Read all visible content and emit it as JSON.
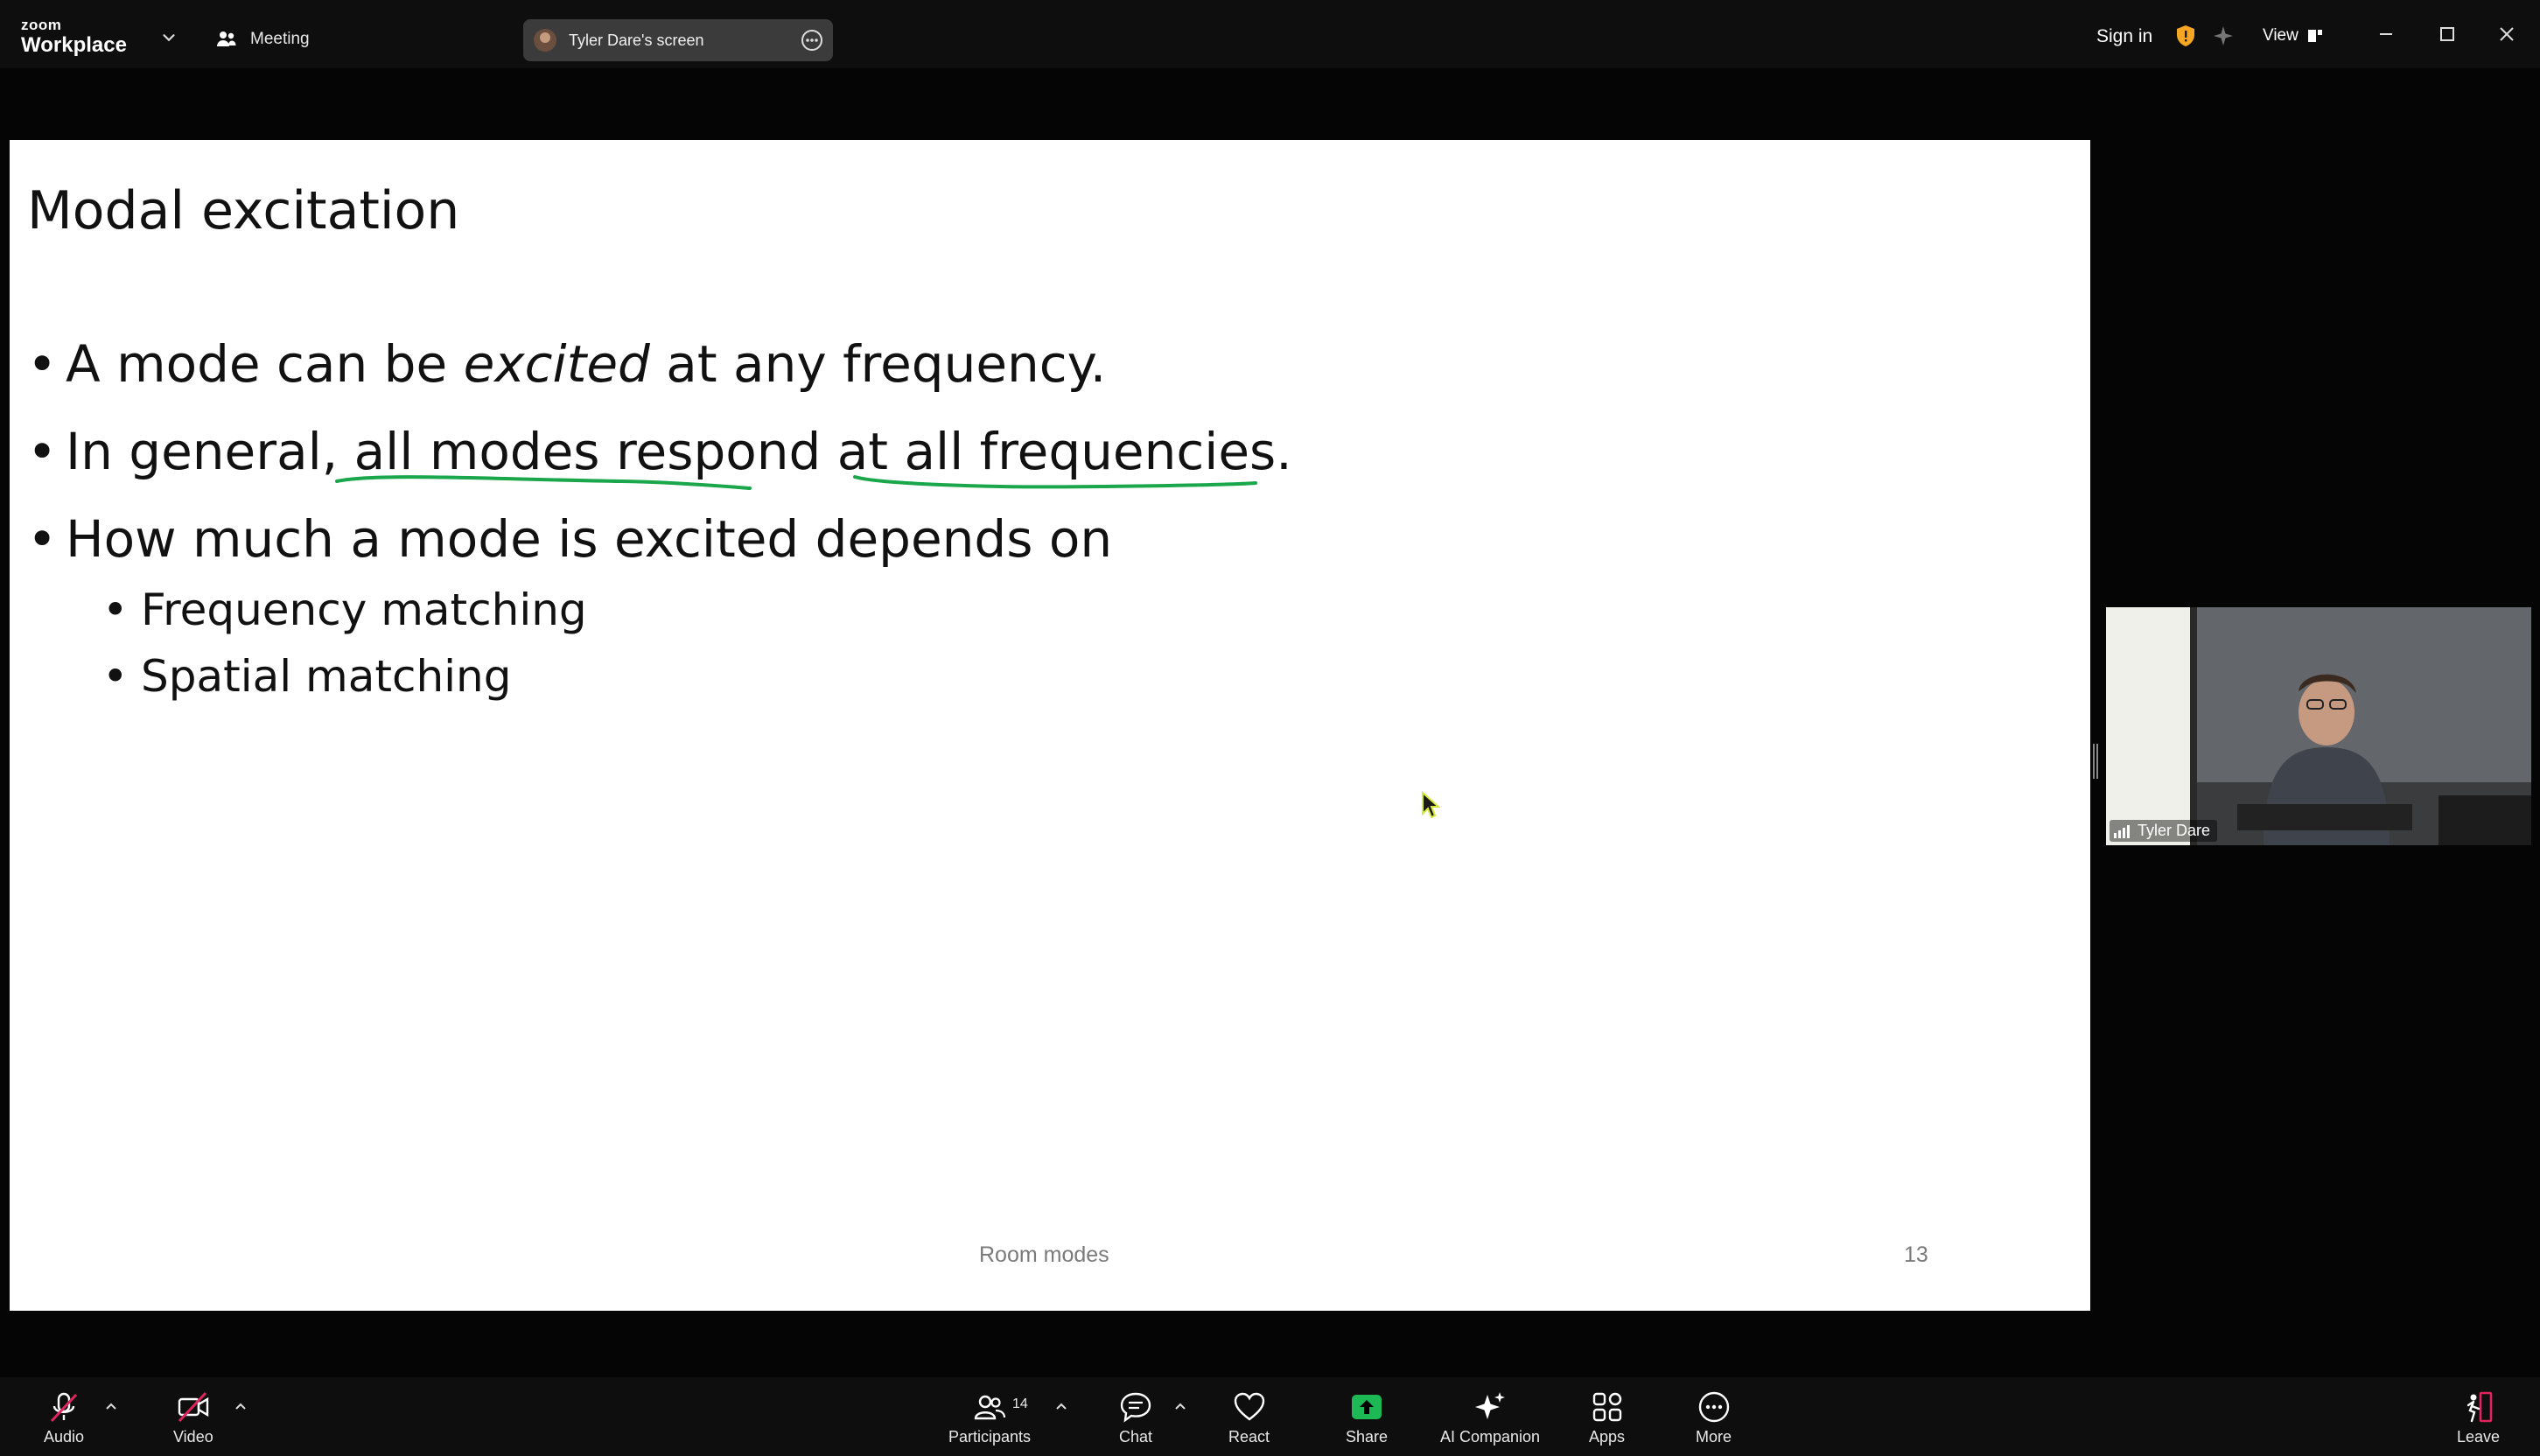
{
  "topbar": {
    "logo_small": "zoom",
    "logo_big": "Workplace",
    "meeting_label": "Meeting",
    "screen_label": "Tyler Dare's screen",
    "sign_in": "Sign in",
    "view_label": "View"
  },
  "slide": {
    "title": "Modal excitation",
    "bullet1_pre": "A mode can be ",
    "bullet1_em": "excited",
    "bullet1_post": " at any frequency.",
    "bullet2": "In general, all modes respond at all frequencies.",
    "bullet3": "How much a mode is excited depends on",
    "sub1": "Frequency matching",
    "sub2": "Spatial matching",
    "footer_center": "Room modes",
    "page_number": "13",
    "ink_color": "#1aa64a"
  },
  "self_view": {
    "name": "Tyler Dare"
  },
  "toolbar": {
    "audio": "Audio",
    "video": "Video",
    "participants": "Participants",
    "participants_count": "14",
    "chat": "Chat",
    "react": "React",
    "share": "Share",
    "ai_companion": "AI Companion",
    "apps": "Apps",
    "more": "More",
    "leave": "Leave",
    "share_color": "#1db954",
    "muted_color": "#e0245e"
  }
}
